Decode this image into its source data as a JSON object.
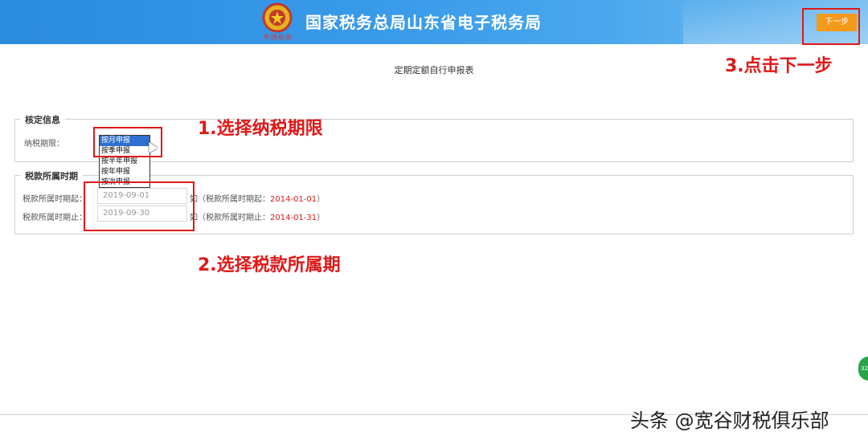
{
  "header": {
    "site_title": "国家税务总局山东省电子税务局",
    "emblem_caption": "中国税务",
    "next_button": "下一步"
  },
  "page_title": "定期定额自行申报表",
  "annotations": {
    "step1": "1.选择纳税期限",
    "step2": "2.选择税款所属期",
    "step3": "3.点击下一步"
  },
  "assessment_section": {
    "legend": "核定信息",
    "period_label": "纳税期限：",
    "period_options": [
      "按月申报",
      "按季申报",
      "按半年申报",
      "按年申报",
      "按次申报"
    ],
    "selected_option": "按月申报"
  },
  "tax_period_section": {
    "legend": "税款所属时期",
    "start_label": "税款所属时期起：",
    "start_value": "2019-09-01",
    "start_hint_prefix": "如（税款所属时期起：",
    "start_hint_example": "2014-01-01",
    "start_hint_suffix": "）",
    "end_label": "税款所属时期止：",
    "end_value": "2019-09-30",
    "end_hint_prefix": "如（税款所属时期止：",
    "end_hint_example": "2014-01-31",
    "end_hint_suffix": "）"
  },
  "watermark": "头条 @宽谷财税俱乐部",
  "float_button": "32",
  "colors": {
    "header_blue": "#3a9bea",
    "next_button_orange": "#f39a1a",
    "annotation_red": "#e01818",
    "selected_option_blue": "#2f6fcf"
  }
}
